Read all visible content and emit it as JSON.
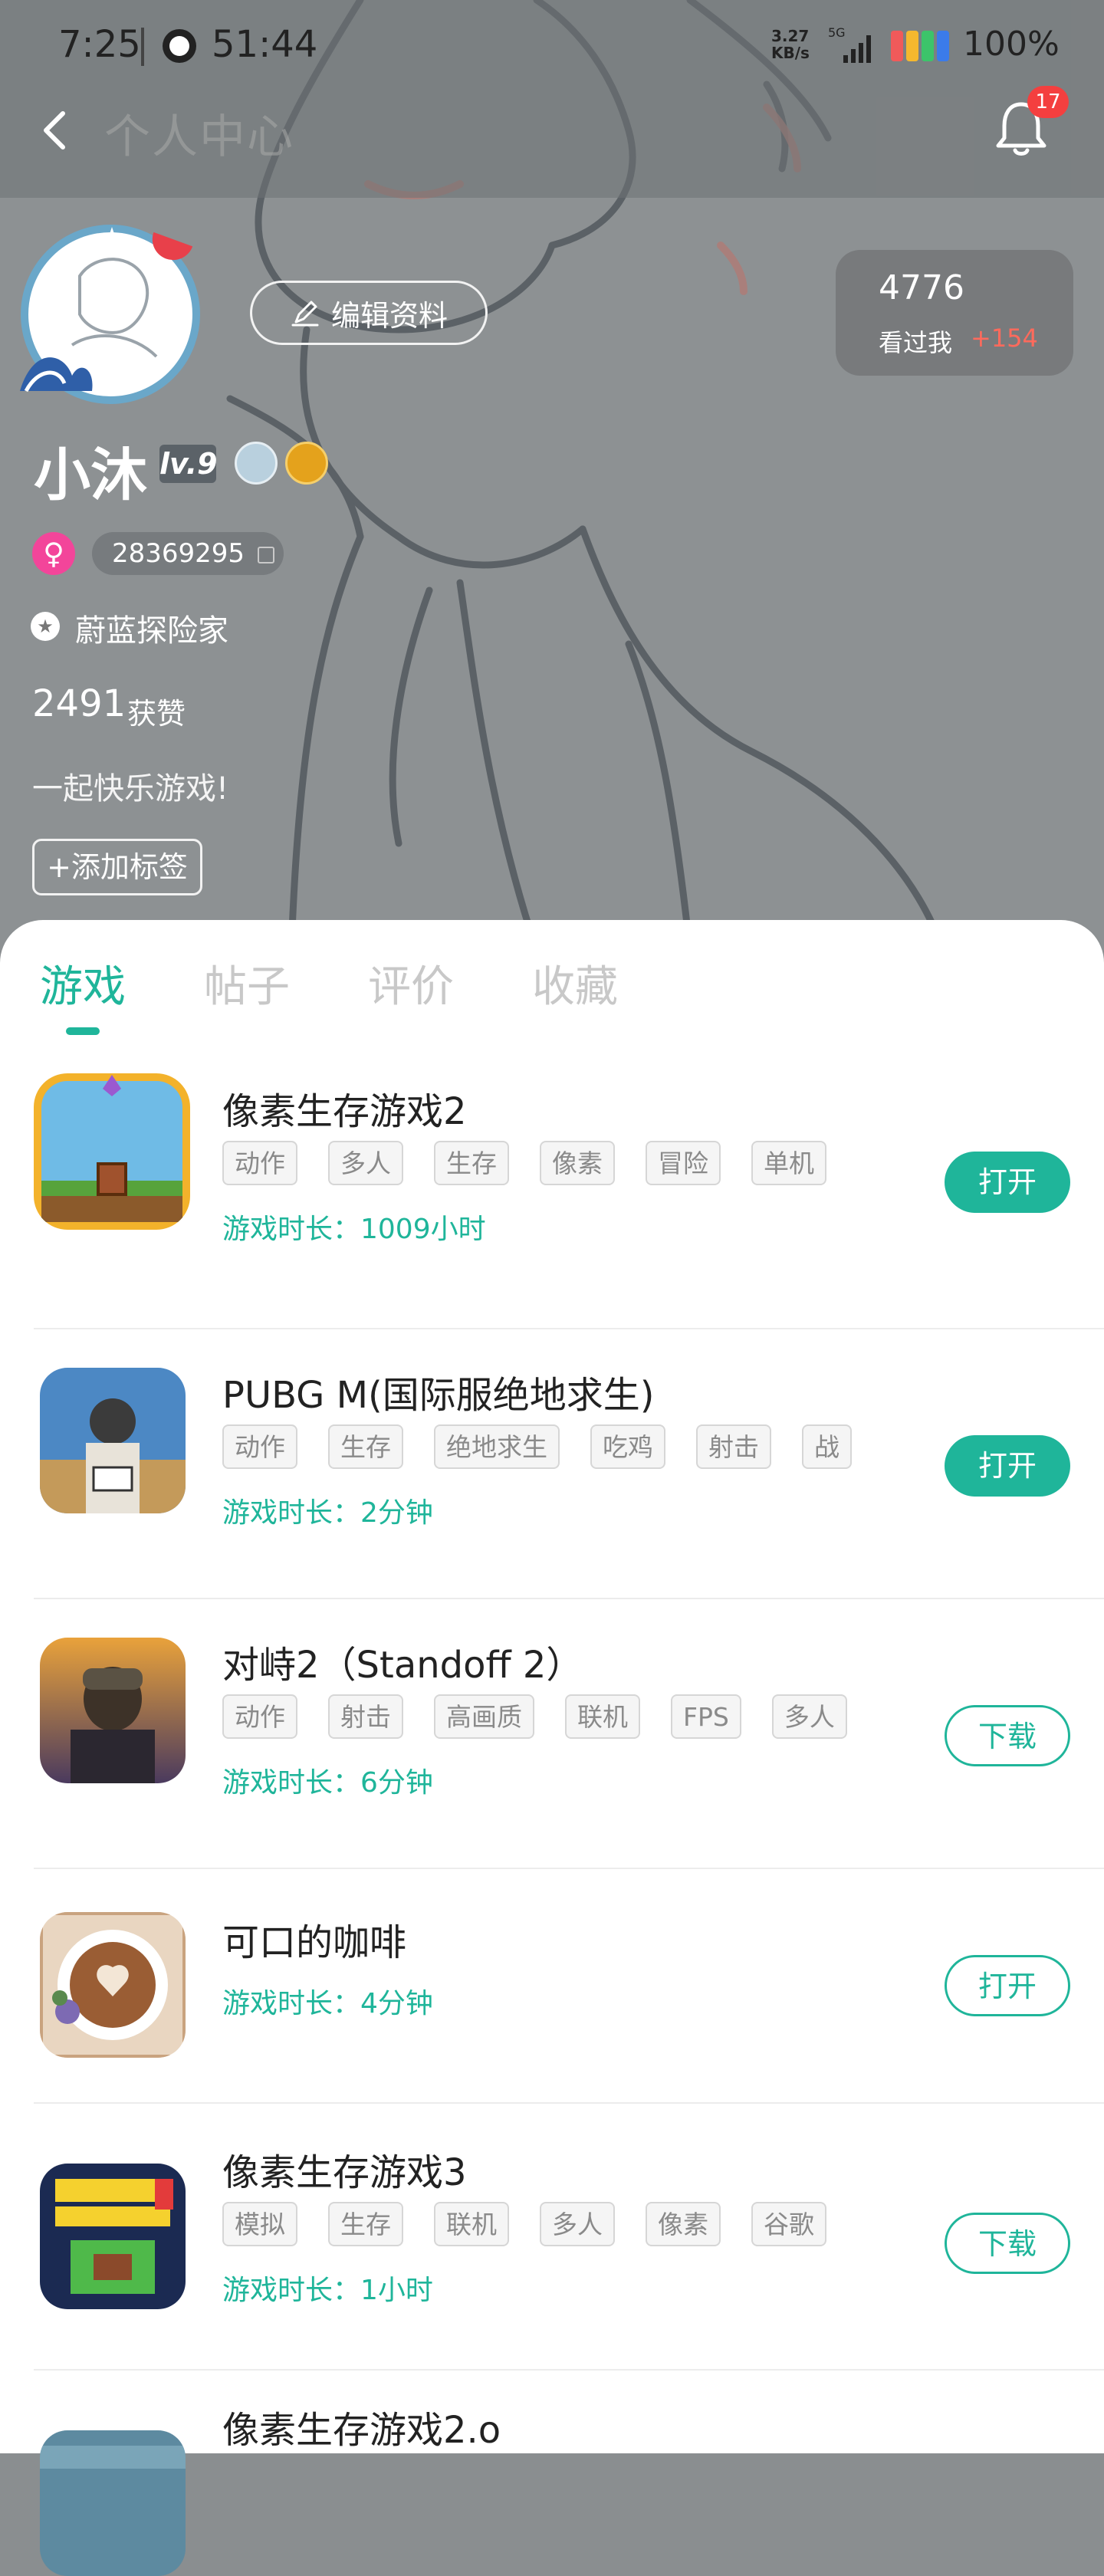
{
  "status_bar": {
    "time": "7:25",
    "timer": "51:44",
    "net_speed_value": "3.27",
    "net_speed_unit": "KB/s",
    "network": "5G",
    "battery": "100%"
  },
  "header": {
    "title": "个人中心",
    "notification_count": "17"
  },
  "profile": {
    "edit_label": "编辑资料",
    "views_count": "4776",
    "views_label": "看过我",
    "views_delta": "+154",
    "username": "小沐",
    "level": "lv.9",
    "gender_symbol": "♀",
    "uid": "28369295",
    "rank_title": "蔚蓝探险家",
    "likes_count": "2491",
    "likes_label": "获赞",
    "bio": "一起快乐游戏!",
    "add_tag_label": "+添加标签"
  },
  "tabs": [
    {
      "label": "游戏",
      "active": true
    },
    {
      "label": "帖子",
      "active": false
    },
    {
      "label": "评价",
      "active": false
    },
    {
      "label": "收藏",
      "active": false
    }
  ],
  "games": [
    {
      "title": "像素生存游戏2",
      "tags": [
        "动作",
        "多人",
        "生存",
        "像素",
        "冒险",
        "单机"
      ],
      "playtime": "游戏时长：1009小时",
      "button": "打开",
      "button_style": "solid",
      "icon": "pixel-survival-2-icon"
    },
    {
      "title": "PUBG M(国际服绝地求生)",
      "tags": [
        "动作",
        "生存",
        "绝地求生",
        "吃鸡",
        "射击",
        "战"
      ],
      "playtime": "游戏时长：2分钟",
      "button": "打开",
      "button_style": "solid",
      "icon": "pubg-mobile-icon"
    },
    {
      "title": "对峙2（Standoff 2）",
      "tags": [
        "动作",
        "射击",
        "高画质",
        "联机",
        "FPS",
        "多人"
      ],
      "playtime": "游戏时长：6分钟",
      "button": "下载",
      "button_style": "outline",
      "icon": "standoff-2-icon"
    },
    {
      "title": "可口的咖啡",
      "tags": [],
      "playtime": "游戏时长：4分钟",
      "button": "打开",
      "button_style": "outline",
      "icon": "coffee-icon"
    },
    {
      "title": "像素生存游戏3",
      "tags": [
        "模拟",
        "生存",
        "联机",
        "多人",
        "像素",
        "谷歌"
      ],
      "playtime": "游戏时长：1小时",
      "button": "下载",
      "button_style": "outline",
      "icon": "pixel-survival-3-icon"
    },
    {
      "title": "像素生存游戏2.o",
      "tags": [],
      "playtime": "",
      "button": "",
      "button_style": "outline",
      "icon": "pixel-survival-2o-icon"
    }
  ],
  "colors": {
    "accent": "#1fb59a",
    "badge_red": "#f43f3f",
    "delta_red": "#ff6a5c",
    "female_pink": "#f3459a"
  }
}
